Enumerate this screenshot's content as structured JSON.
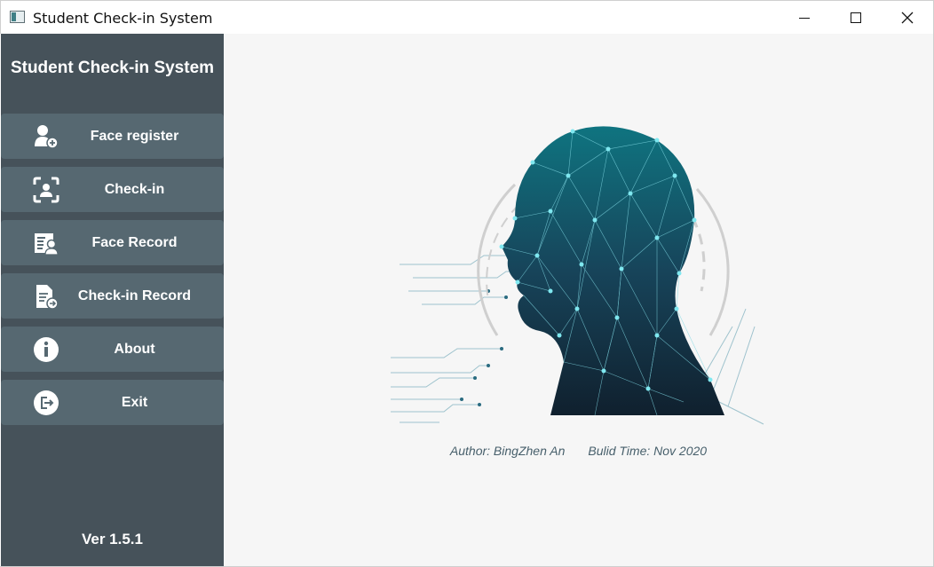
{
  "window": {
    "title": "Student Check-in System"
  },
  "sidebar": {
    "title": "Student Check-in System",
    "items": [
      {
        "label": "Face register",
        "icon": "user-add-icon"
      },
      {
        "label": "Check-in",
        "icon": "face-scan-icon"
      },
      {
        "label": "Face Record",
        "icon": "id-card-icon"
      },
      {
        "label": "Check-in Record",
        "icon": "document-arrow-icon"
      },
      {
        "label": "About",
        "icon": "info-icon"
      },
      {
        "label": "Exit",
        "icon": "exit-icon"
      }
    ],
    "version": "Ver 1.5.1"
  },
  "main": {
    "author": "Author: BingZhen An",
    "build_time": "Bulid Time: Nov 2020"
  },
  "colors": {
    "sidebar_bg": "#46525a",
    "button_bg": "#566871",
    "main_bg": "#f6f6f6",
    "accent": "#0f6f7f",
    "info_text": "#48606c"
  }
}
